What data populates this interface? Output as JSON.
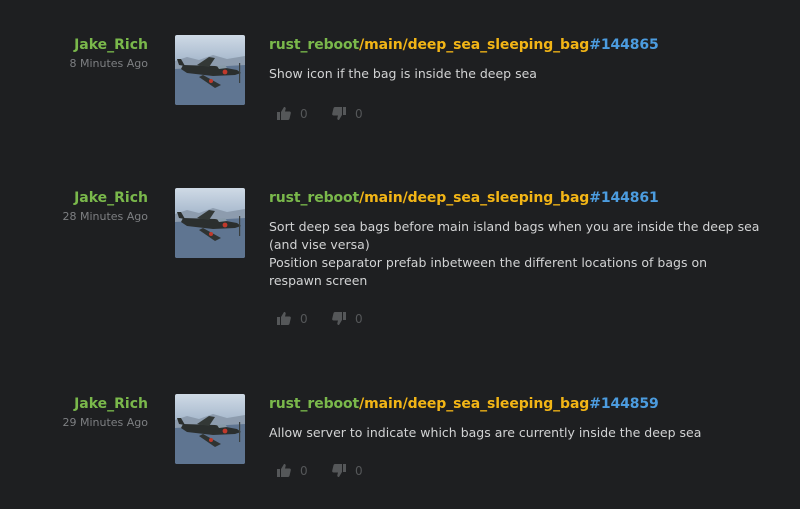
{
  "commits": [
    {
      "author": "Jake_Rich",
      "time": "8 Minutes Ago",
      "repo": "rust_reboot",
      "branch": "/main/deep_sea_sleeping_bag",
      "changeset": "#144865",
      "message_lines": [
        "Show icon if the bag is inside the deep sea"
      ],
      "likes": "0",
      "dislikes": "0",
      "avatar_icon": "fighter-plane-photo"
    },
    {
      "author": "Jake_Rich",
      "time": "28 Minutes Ago",
      "repo": "rust_reboot",
      "branch": "/main/deep_sea_sleeping_bag",
      "changeset": "#144861",
      "message_lines": [
        "Sort deep sea bags before main island bags when you are inside the deep sea",
        "(and vise versa)",
        "Position separator prefab inbetween the different locations of bags on",
        "respawn screen"
      ],
      "likes": "0",
      "dislikes": "0",
      "avatar_icon": "fighter-plane-photo"
    },
    {
      "author": "Jake_Rich",
      "time": "29 Minutes Ago",
      "repo": "rust_reboot",
      "branch": "/main/deep_sea_sleeping_bag",
      "changeset": "#144859",
      "message_lines": [
        "Allow server to indicate which bags are currently inside the deep sea"
      ],
      "likes": "0",
      "dislikes": "0",
      "avatar_icon": "fighter-plane-photo"
    }
  ],
  "colors": {
    "background": "#1e1f21",
    "author": "#7ab84b",
    "repo": "#7ab84b",
    "branch": "#f2b516",
    "changeset": "#4c9cdf",
    "message": "#d2d3d4",
    "muted": "#7d7f82",
    "vote": "#555759"
  }
}
